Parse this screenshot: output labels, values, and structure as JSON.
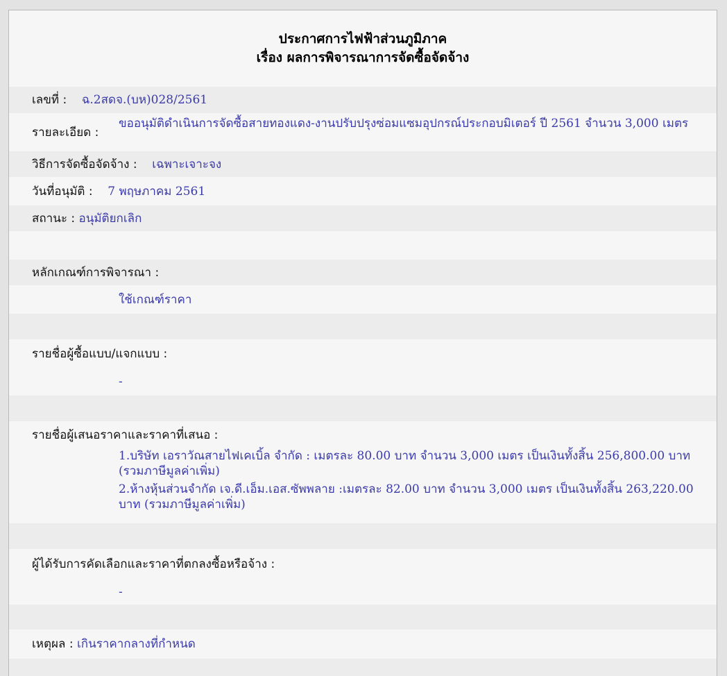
{
  "title_line1": "ประกาศการไฟฟ้าส่วนภูมิภาค",
  "title_line2": "เรื่อง ผลการพิจารณาการจัดซื้อจัดจ้าง",
  "number": {
    "label": "เลขที่ :",
    "value": "ฉ.2สดจ.(บห)028/2561"
  },
  "detail": {
    "label": "รายละเอียด :",
    "value": "ขออนุมัติดำเนินการจัดซื้อสายทองแดง-งานปรับปรุงซ่อมแซมอุปกรณ์ประกอบมิเตอร์ ปี 2561 จำนวน 3,000 เมตร"
  },
  "method": {
    "label": "วิธีการจัดซื้อจัดจ้าง :",
    "value": "เฉพาะเจาะจง"
  },
  "approval_date": {
    "label": "วันที่อนุมัติ :",
    "value": "7 พฤษภาคม 2561"
  },
  "status": {
    "label": "สถานะ :",
    "value": "อนุมัติยกเลิก"
  },
  "criteria": {
    "label": "หลักเกณฑ์การพิจารณา :",
    "value": "ใช้เกณฑ์ราคา"
  },
  "buyers": {
    "label": "รายชื่อผู้ซื้อแบบ/แจกแบบ :",
    "value": "-"
  },
  "bidders": {
    "label": "รายชื่อผู้เสนอราคาและราคาที่เสนอ :",
    "items": [
      "1.บริษัท เอราวัณสายไฟเคเบิ้ล จำกัด : เมตรละ 80.00 บาท จำนวน 3,000 เมตร เป็นเงินทั้งสิ้น 256,800.00 บาท (รวมภาษีมูลค่าเพิ่ม)",
      "2.ห้างหุ้นส่วนจำกัด เจ.ดี.เอ็ม.เอส.ซัพพลาย :เมตรละ 82.00 บาท จำนวน 3,000 เมตร เป็นเงินทั้งสิ้น 263,220.00 บาท (รวมภาษีมูลค่าเพิ่ม)"
    ]
  },
  "winner": {
    "label": "ผู้ได้รับการคัดเลือกและราคาที่ตกลงซื้อหรือจ้าง :",
    "value": "-"
  },
  "reason": {
    "label": "เหตุผล :",
    "value": "เกินราคากลางที่กำหนด"
  }
}
